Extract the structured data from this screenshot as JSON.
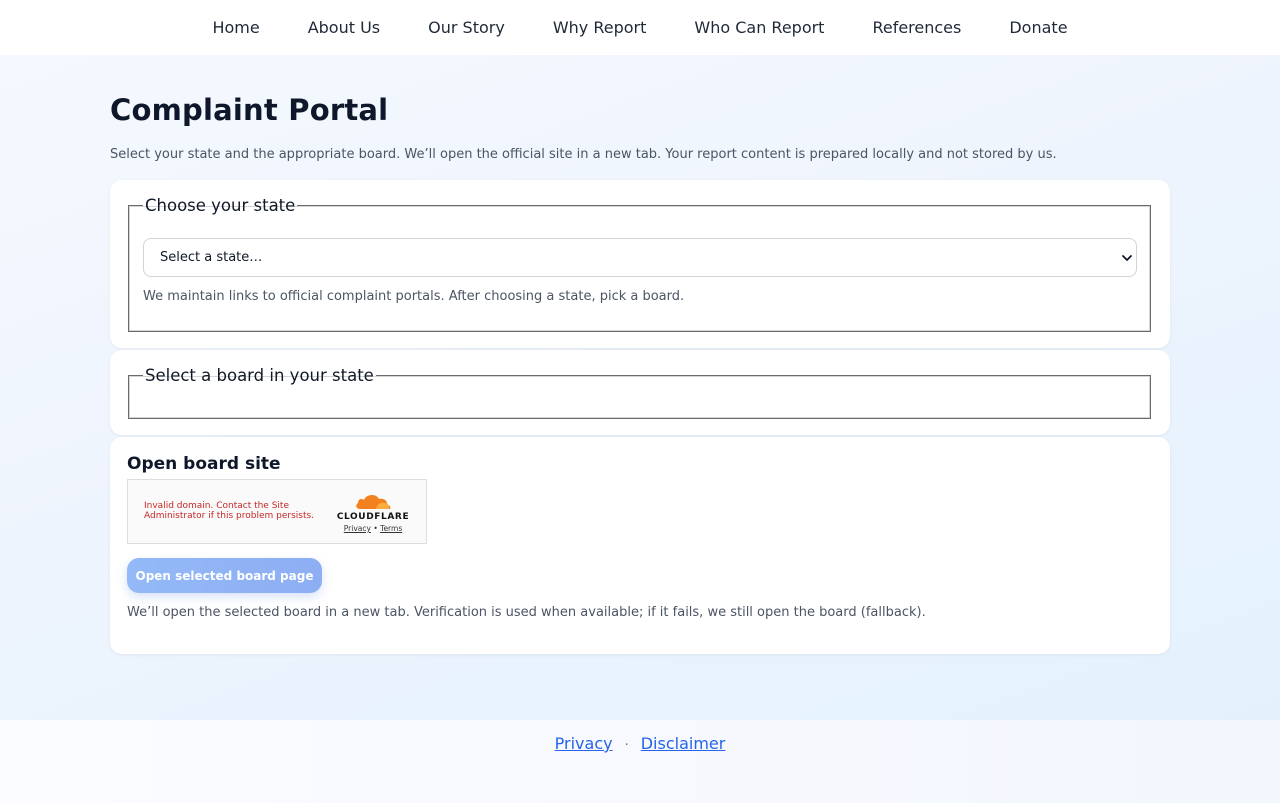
{
  "nav": {
    "items": [
      {
        "label": "Home"
      },
      {
        "label": "About Us"
      },
      {
        "label": "Our Story"
      },
      {
        "label": "Why Report"
      },
      {
        "label": "Who Can Report"
      },
      {
        "label": "References"
      },
      {
        "label": "Donate"
      }
    ]
  },
  "page": {
    "title": "Complaint Portal",
    "intro": "Select your state and the appropriate board. We’ll open the official site in a new tab. Your report content is prepared locally and not stored by us."
  },
  "state_section": {
    "legend": "Choose your state",
    "select_value": "Select a state…",
    "help": "We maintain links to official complaint portals. After choosing a state, pick a board."
  },
  "board_section": {
    "legend": "Select a board in your state"
  },
  "open_section": {
    "heading": "Open board site",
    "captcha": {
      "error": "Invalid domain. Contact the Site Administrator if this problem persists.",
      "brand": "CLOUDFLARE",
      "privacy": "Privacy",
      "separator": "•",
      "terms": "Terms"
    },
    "button_label": "Open selected board page",
    "help": "We’ll open the selected board in a new tab. Verification is used when available; if it fails, we still open the board (fallback)."
  },
  "footer": {
    "privacy": "Privacy",
    "separator": "·",
    "disclaimer": "Disclaimer"
  },
  "colors": {
    "accent": "#2563eb",
    "button": "#8eaef3",
    "error": "#c62828",
    "cloudflare_orange": "#f48120"
  }
}
